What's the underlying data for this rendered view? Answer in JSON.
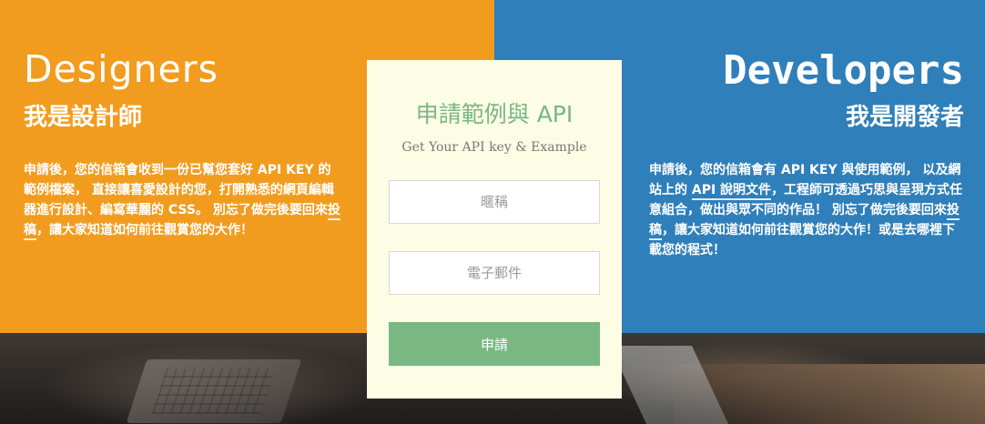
{
  "designers": {
    "title": "Designers",
    "subtitle": "我是設計師",
    "desc_part1": "申請後，您的信箱會收到一份已幫您套好 API KEY 的範例檔案， 直接讓喜愛設計的您，打開熟悉的網頁編輯器進行設計、編寫華麗的 CSS。 別忘了做完後要回來",
    "link": "投稿",
    "desc_part2": "，讓大家知道如何前往觀賞您的大作！"
  },
  "developers": {
    "title": "Developers",
    "subtitle": "我是開發者",
    "desc_part1": "申請後，您的信箱會有 API KEY 與使用範例， 以及網站上的 ",
    "link_api": "API 說明文件",
    "desc_part2": "，工程師可透過巧思與呈現方式任意組合，做出與眾不同的作品！ 別忘了做完後要回來",
    "link_submit": "投稿",
    "desc_part3": "，讓大家知道如何前往觀賞您的大作！或是去哪裡下載您的程式！"
  },
  "form": {
    "title": "申請範例與 API",
    "subtitle": "Get Your API key & Example",
    "nickname_placeholder": "暱稱",
    "email_placeholder": "電子郵件",
    "submit_label": "申請"
  },
  "colors": {
    "orange": "#f29c1f",
    "blue": "#2f7fba",
    "green": "#79b783",
    "card": "#fdfde6"
  }
}
